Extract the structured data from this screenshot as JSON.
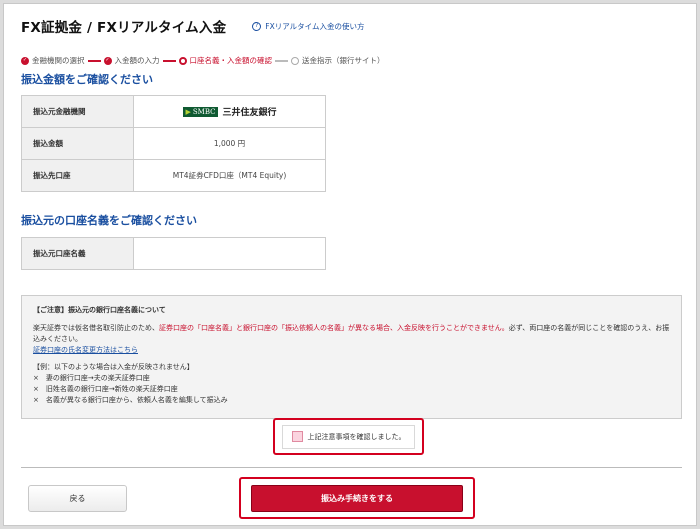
{
  "header": {
    "title": "FX証拠金 / FXリアルタイム入金",
    "help_link": "FXリアルタイム入金の使い方",
    "help_icon": "?"
  },
  "steps": [
    {
      "label": "金融機関の選択",
      "state": "done"
    },
    {
      "label": "入金額の入力",
      "state": "done"
    },
    {
      "label": "口座名義・入金額の確認",
      "state": "current"
    },
    {
      "label": "送金指示（銀行サイト）",
      "state": "todo"
    }
  ],
  "section1": {
    "title": "振込金額をご確認ください",
    "rows": {
      "bank_label": "振込元金融機関",
      "bank_logo_text": "SMBC",
      "bank_name": "三井住友銀行",
      "amount_label": "振込金額",
      "amount_value": "1,000 円",
      "dest_label": "振込先口座",
      "dest_value": "MT4証券CFD口座（MT4 Equity)"
    }
  },
  "section2": {
    "title": "振込元の口座名義をご確認ください",
    "holder_label": "振込元口座名義",
    "holder_value": ""
  },
  "notice": {
    "heading": "【ご注意】振込元の銀行口座名義について",
    "para_prefix": "楽天証券では仮名借名取引防止のため、",
    "para_red": "証券口座の「口座名義」と銀行口座の「振込依頼人の名義」が異なる場合、入金反映を行うことができません。",
    "para_suffix": "必ず、両口座の名義が同じことを確認のうえ、お振込みください。",
    "link": "証券口座の氏名変更方法はこちら",
    "example_heading": "【例：以下のような場合は入金が反映されません】",
    "examples": [
      "×　妻の銀行口座→夫の楽天証券口座",
      "×　旧姓名義の銀行口座→新姓の楽天証券口座",
      "×　名義が異なる銀行口座から、依頼人名義を編集して振込み"
    ]
  },
  "confirm": {
    "label": "上記注意事項を確認しました。",
    "checked": false
  },
  "buttons": {
    "back": "戻る",
    "submit": "振込み手続きをする"
  },
  "colors": {
    "accent_red": "#c8102e",
    "title_blue": "#1a4fa0",
    "highlight_border": "#d3001f"
  }
}
